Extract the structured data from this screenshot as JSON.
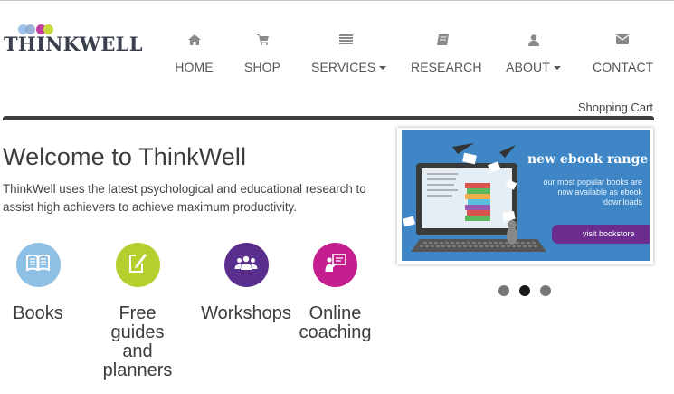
{
  "logo": {
    "text": "THINKWELL",
    "dot_colors": [
      "#9fc2e8",
      "#8aa6d0",
      "#c23fa0",
      "#c9d83c"
    ]
  },
  "nav": {
    "items": [
      {
        "label": "HOME",
        "icon": "home-icon"
      },
      {
        "label": "SHOP",
        "icon": "cart-icon"
      },
      {
        "label": "SERVICES",
        "icon": "list-icon",
        "dropdown": true
      },
      {
        "label": "RESEARCH",
        "icon": "book-icon"
      },
      {
        "label": "ABOUT",
        "icon": "user-icon",
        "dropdown": true
      },
      {
        "label": "CONTACT",
        "icon": "envelope-icon"
      }
    ]
  },
  "cart": {
    "label": "Shopping Cart"
  },
  "welcome": {
    "title": "Welcome to ThinkWell",
    "text": "ThinkWell uses the latest psychological and educational research to assist high achievers to achieve maximum productivity."
  },
  "features": [
    {
      "label": "Books",
      "icon": "open-book-icon",
      "color": "#8ec0e6"
    },
    {
      "label": "Free guides and planners",
      "icon": "pen-document-icon",
      "color": "#b7cf2e"
    },
    {
      "label": "Workshops",
      "icon": "group-icon",
      "color": "#5a2e8c"
    },
    {
      "label": "Online coaching",
      "icon": "presenter-icon",
      "color": "#c41f8e"
    }
  ],
  "carousel": {
    "title": "new ebook range",
    "text": "our most popular books are now available as ebook downloads",
    "button": "visit bookstore",
    "slides": 3,
    "active_slide": 2,
    "colors": {
      "banner": "#3e86c6",
      "button": "#6a2c8e"
    }
  }
}
